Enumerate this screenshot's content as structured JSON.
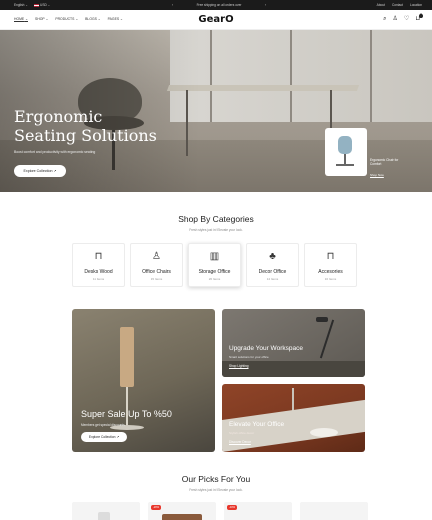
{
  "topbar": {
    "language": "English",
    "currency": "USD",
    "announcement": "Free shipping on all orders over",
    "prev_arrow": "‹",
    "next_arrow": "›",
    "links": [
      "About",
      "Contact",
      "Location"
    ]
  },
  "header": {
    "logo": "GearO",
    "nav": [
      "Home",
      "Shop",
      "Products",
      "Blogs",
      "Pages"
    ],
    "icons": [
      "search-icon",
      "user-icon",
      "heart-icon",
      "cart-icon"
    ],
    "cart_count": "0"
  },
  "hero": {
    "title_line1": "Ergonomic",
    "title_line2": "Seating Solutions",
    "subtitle": "Boost comfort and productivity with ergonomic seating",
    "button": "Explore Collection ↗",
    "product_name": "Ergonomic Chair for Comfort",
    "product_link": "Shop Now",
    "dots": "• • •",
    "arrow": "›"
  },
  "categories": {
    "title": "Shop By Categories",
    "subtitle": "Fresh styles just in! Elevate your look.",
    "items": [
      {
        "name": "Desks Wood",
        "count": "11 Items",
        "icon": "desk-icon",
        "glyph": "⊓"
      },
      {
        "name": "Office Chairs",
        "count": "15 Items",
        "icon": "chair-icon",
        "glyph": "♙"
      },
      {
        "name": "Storage Office",
        "count": "26 Items",
        "icon": "storage-icon",
        "glyph": "▥"
      },
      {
        "name": "Decor Office",
        "count": "14 Items",
        "icon": "plant-icon",
        "glyph": "♣"
      },
      {
        "name": "Accesories",
        "count": "16 Items",
        "icon": "table-icon",
        "glyph": "⊓"
      }
    ],
    "selected_index": 2
  },
  "banners": {
    "sale": {
      "title": "Super Sale Up To %50",
      "subtitle": "Members get special discounts",
      "button": "Explore Collection ↗"
    },
    "workspace": {
      "title": "Upgrade Your Workspace",
      "subtitle": "Smart solutions for your office",
      "link": "Shop Lighting"
    },
    "office": {
      "title": "Elevate Your Office",
      "subtitle": "Stylish office decor",
      "link": "Discover Decor"
    }
  },
  "picks": {
    "title": "Our Picks For You",
    "subtitle": "Fresh styles just in! Elevate your look.",
    "badges": [
      "",
      "-20%",
      "-10%",
      ""
    ]
  },
  "colors": {
    "topbar_bg": "#1b1b1b",
    "sale_badge": "#e8372c",
    "accent_dark": "#222222"
  }
}
